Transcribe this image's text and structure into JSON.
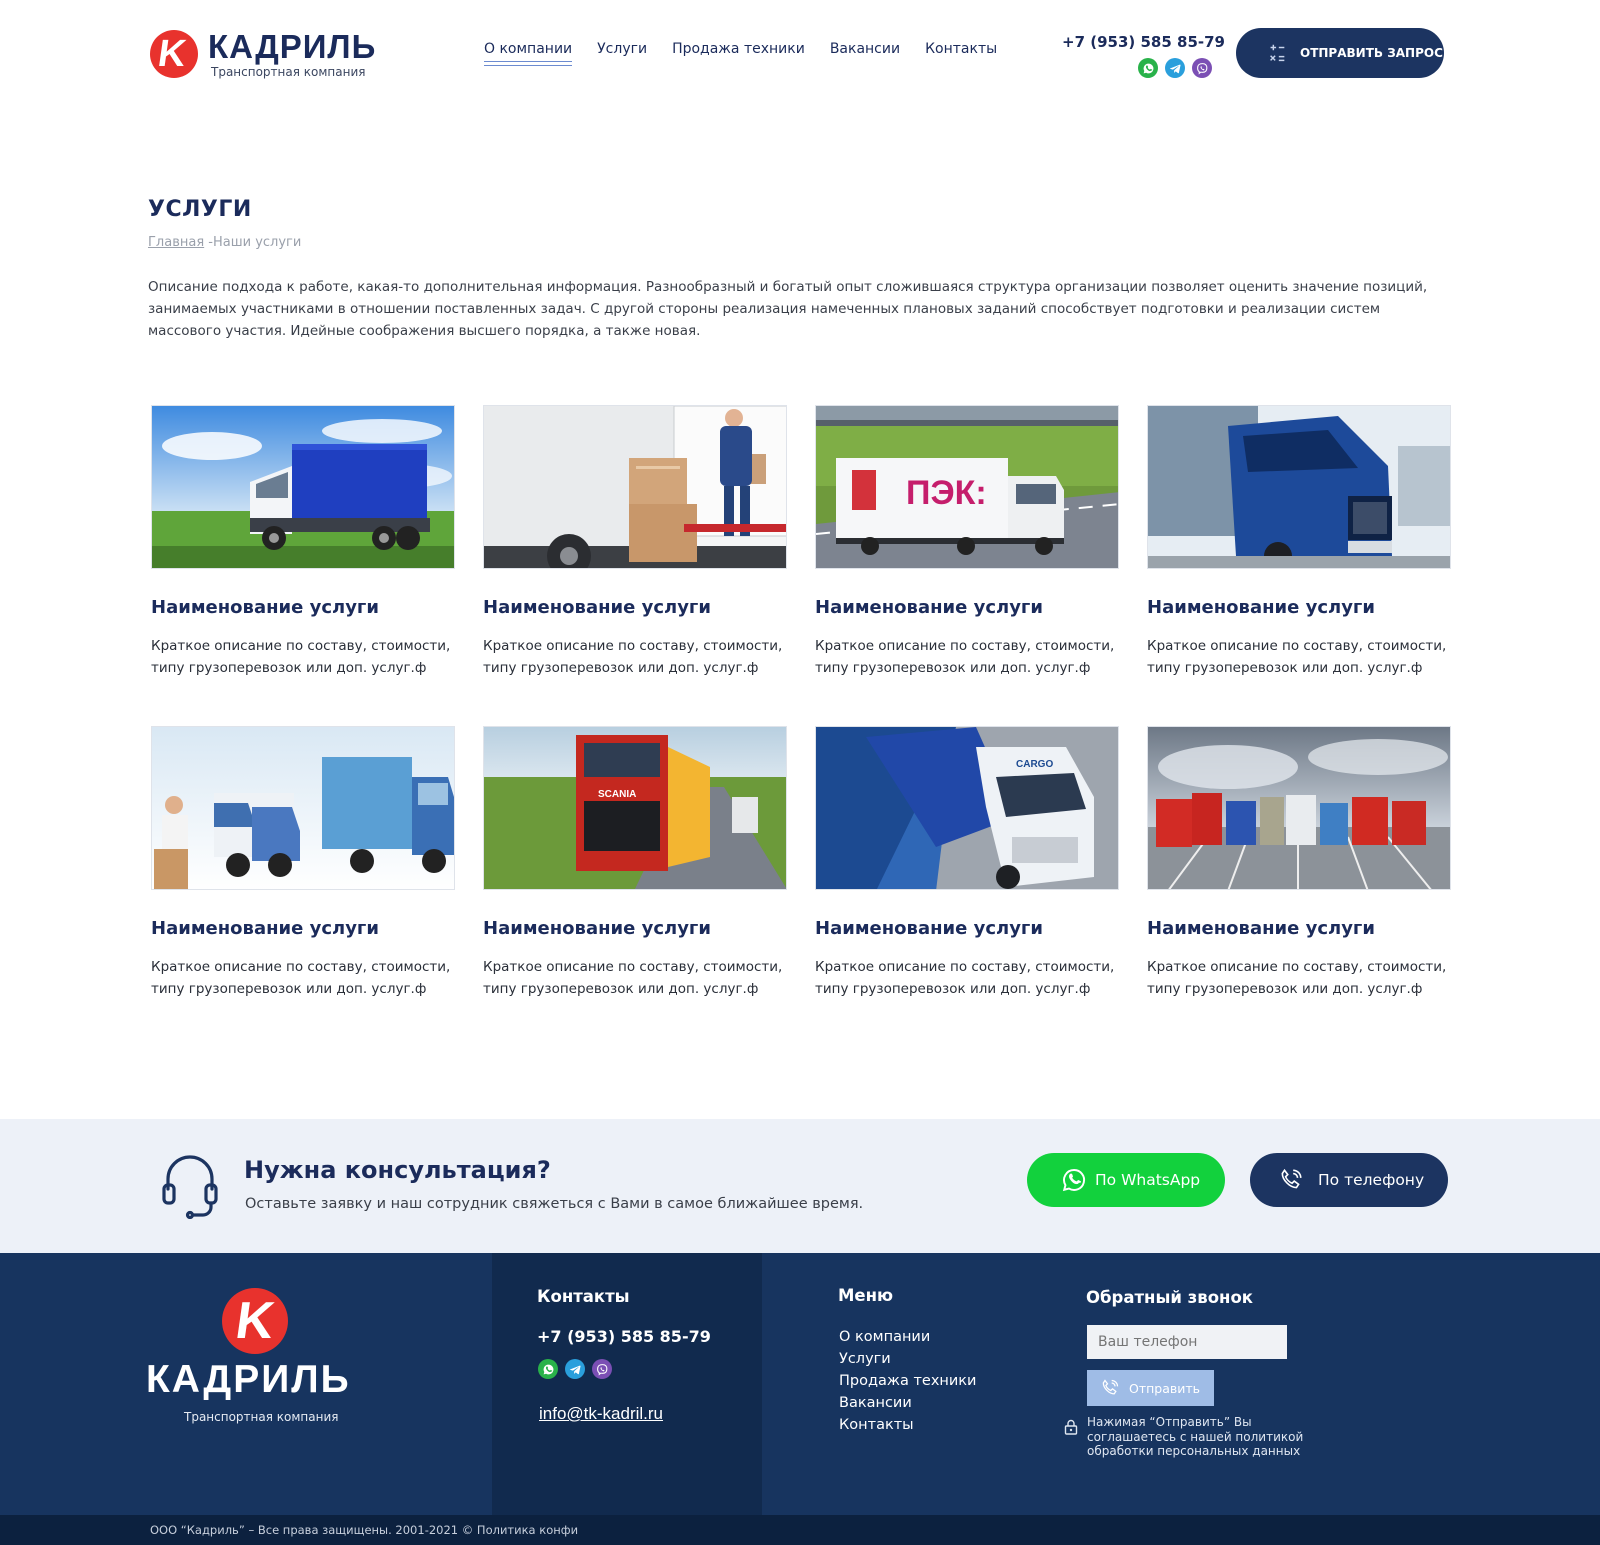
{
  "header": {
    "logo_name": "КАДРИЛЬ",
    "logo_sub": "Транспортная компания",
    "nav": [
      {
        "label": "О компании",
        "active": true
      },
      {
        "label": "Услуги",
        "active": false
      },
      {
        "label": "Продажа техники",
        "active": false
      },
      {
        "label": "Вакансии",
        "active": false
      },
      {
        "label": "Контакты",
        "active": false
      }
    ],
    "phone": "+7 (953) 585 85-79",
    "request_button": "ОТПРАВИТЬ ЗАПРОС"
  },
  "page": {
    "title": "УСЛУГИ",
    "breadcrumb_home": "Главная",
    "breadcrumb_current": " -Наши услуги",
    "intro": "Описание подхода к работе, какая-то дополнительная информация. Разнообразный и богатый опыт сложившаяся структура организации позволяет оценить значение позиций, занимаемых участниками в отношении поставленных задач. С другой стороны реализация намеченных плановых заданий способствует подготовки и реализации систем массового участия. Идейные соображения высшего порядка, а также новая."
  },
  "services": [
    {
      "title": "Наименование услуги",
      "desc": "Краткое описание по составу, стоимости, типу грузоперевозок или доп. услуг.ф",
      "image": "white-truck-blue-tarp"
    },
    {
      "title": "Наименование услуги",
      "desc": "Краткое описание по составу, стоимости, типу грузоперевозок или доп. услуг.ф",
      "image": "loader-with-boxes"
    },
    {
      "title": "Наименование услуги",
      "desc": "Краткое описание по составу, стоимости, типу грузоперевозок или доп. услуг.ф",
      "image": "pek-truck-highway"
    },
    {
      "title": "Наименование услуги",
      "desc": "Краткое описание по составу, стоимости, типу грузоперевозок или доп. услуг.ф",
      "image": "blue-volvo-truck"
    },
    {
      "title": "Наименование услуги",
      "desc": "Краткое описание по составу, стоимости, типу грузоперевозок или доп. услуг.ф",
      "image": "van-and-blue-truck"
    },
    {
      "title": "Наименование услуги",
      "desc": "Краткое описание по составу, стоимости, типу грузоперевозок или доп. услуг.ф",
      "image": "red-scania-truck"
    },
    {
      "title": "Наименование услуги",
      "desc": "Краткое описание по составу, стоимости, типу грузоперевозок или доп. услуг.ф",
      "image": "cargo-express-truck"
    },
    {
      "title": "Наименование услуги",
      "desc": "Краткое описание по составу, стоимости, типу грузоперевозок или доп. услуг.ф",
      "image": "truck-fleet-lineup"
    }
  ],
  "consult": {
    "title": "Нужна консультация?",
    "subtitle": "Оставьте заявку и наш сотрудник свяжеться с Вами в самое ближайшее время.",
    "whatsapp_button": "По WhatsApp",
    "phone_button": "По телефону"
  },
  "footer": {
    "logo_name": "КАДРИЛЬ",
    "logo_sub": "Транспортная компания",
    "contacts_head": "Контакты",
    "phone": "+7 (953) 585 85-79",
    "email": "info@tk-kadril.ru",
    "menu_head": "Меню",
    "menu": [
      "О компании",
      "Услуги",
      "Продажа техники",
      "Вакансии",
      "Контакты"
    ],
    "callback_head": "Обратный звонок",
    "phone_placeholder": "Ваш телефон",
    "send_button": "Отправить",
    "consent": "Нажимая “Отправить” Вы соглашаетесь с нашей политикой обработки персональных данных",
    "copyright": "ООО “Кадриль” – Все права защищены.  2001-2021 © Политика конфи"
  },
  "colors": {
    "brand_navy": "#1c3461",
    "brand_red": "#e8322d",
    "whatsapp_green": "#12d13d",
    "footer_bg": "#17345f"
  },
  "icons": [
    "logo-k-icon",
    "whatsapp-icon",
    "telegram-icon",
    "viber-icon",
    "calculator-icon",
    "headset-icon",
    "phone-icon",
    "lock-icon"
  ]
}
